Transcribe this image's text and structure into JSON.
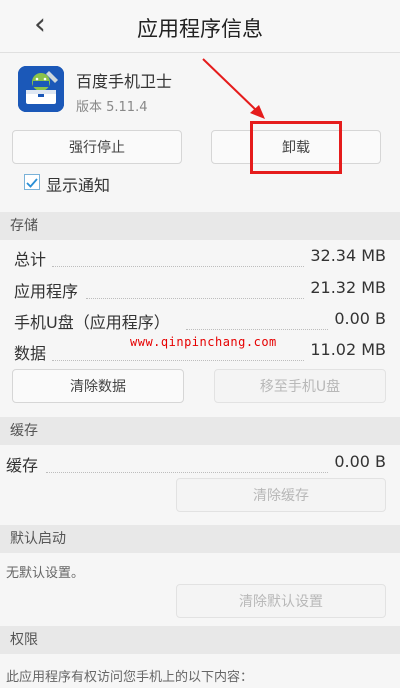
{
  "header": {
    "title": "应用程序信息",
    "back_glyph": "‹"
  },
  "app": {
    "name": "百度手机卫士",
    "version": "版本 5.11.4",
    "icon": "android-toolbox-icon"
  },
  "actions": {
    "force_stop": "强行停止",
    "uninstall": "卸载",
    "highlight_color": "#e51c1c"
  },
  "notification": {
    "label": "显示通知",
    "checked": true
  },
  "storage": {
    "title": "存储",
    "rows": [
      {
        "label": "总计",
        "value": "32.34 MB"
      },
      {
        "label": "应用程序",
        "value": "21.32 MB"
      },
      {
        "label": "手机U盘（应用程序）",
        "value": "0.00 B"
      },
      {
        "label": "数据",
        "value": "11.02 MB"
      }
    ],
    "clear_data": "清除数据",
    "move_to_usb": "移至手机U盘"
  },
  "watermark": "www.qinpinchang.com",
  "cache": {
    "title": "缓存",
    "label": "缓存",
    "value": "0.00 B",
    "clear": "清除缓存"
  },
  "default_launch": {
    "title": "默认启动",
    "text": "无默认设置。",
    "clear": "清除默认设置"
  },
  "permissions": {
    "title": "权限",
    "text": "此应用程序有权访问您手机上的以下内容："
  }
}
